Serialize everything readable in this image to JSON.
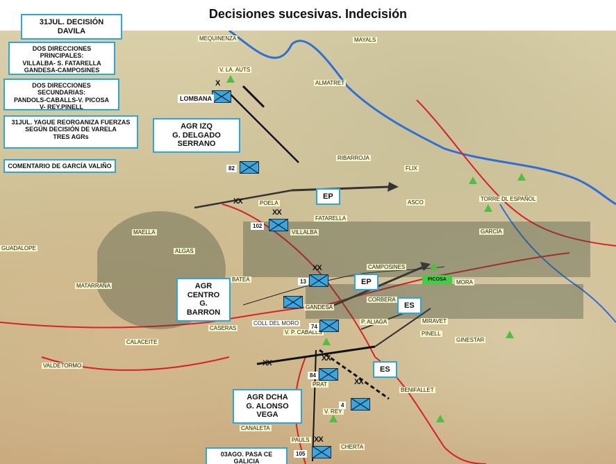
{
  "title": "Decisiones sucesivas. Indecisión",
  "notes": {
    "date_box": "31JUL. DECISIÓN DAVILA",
    "principal": "DOS DIRECCIONES PRINCIPALES:\nVILLALBA- S. FATARELLA\nGANDESA-CAMPOSINES",
    "secundaria": "DOS DIRECCIONES SECUNDARIAS:\nPANDOLS-CABALLS-V. PICOSA\nV- REY.PINELL",
    "yague": "31JUL. YAGUE REORGANIZA FUERZAS\nSEGÚN DECISIÓN DE VARELA\nTRES AGRs",
    "garcia": "COMENTARIO DE GARCÍA VALIÑO"
  },
  "groups": {
    "izq": "AGR IZQ\nG. DELGADO SERRANO",
    "centro": "AGR CENTRO\nG. BARRON",
    "dcha": "AGR DCHA\nG. ALONSO VEGA",
    "galicia": "03AGO. PASA CE GALICIA"
  },
  "tags": {
    "ep1": "EP",
    "ep2": "EP",
    "es1": "ES",
    "es2": "ES"
  },
  "units": {
    "lombana": "LOMBANA",
    "u82": "82",
    "u102": "102",
    "u13": "13",
    "u74": "74",
    "u84": "84",
    "u4": "4",
    "u105": "105"
  },
  "places": {
    "mequinenza": "MEQUINENZA",
    "mayals": "MAYALS",
    "almatret": "ALMATRET",
    "ribarroja": "RIBARROJA",
    "flix": "FLIX",
    "asco": "ASCO",
    "poela": "POELA",
    "fatarella": "FATARELLA",
    "villalba": "VILLALBA",
    "camposines": "CAMPOSINES",
    "mora": "MORA",
    "batea": "BATEA",
    "gandesa": "GANDESA",
    "corbera": "CORBERA",
    "caseras": "CASERAS",
    "algas": "ALGAS",
    "maella": "MAELLA",
    "guadalope": "GUADALOPE",
    "matarrana": "MATARRAÑA",
    "calaceite": "CALACEITE",
    "valdetormo": "VALDETORMO",
    "pinell": "PINELL",
    "miravet": "MIRAVET",
    "ginestar": "GINESTAR",
    "benifallet": "BENIFALLET",
    "canaleta": "CANALETA",
    "pauls": "PAULS",
    "cherta": "CHERTA",
    "garcia": "GARCÍA",
    "torre_espanol": "TORRE DL ESPAÑOL",
    "coll_moro": "COLL DEL MORO",
    "v_picosa": "PICOSA",
    "v_auts": "V. LA. AUTS",
    "v_aliaga": "P. ALIAGA",
    "v_caballs": "V. P. CABALLS",
    "prat": "PRAT",
    "v_rey": "V. REY"
  },
  "colors": {
    "accent_blue": "#2aa6d9",
    "unit_blue": "#3aa6dd",
    "peak_green": "#4fbf3f",
    "picosa_green": "#44cc44"
  }
}
